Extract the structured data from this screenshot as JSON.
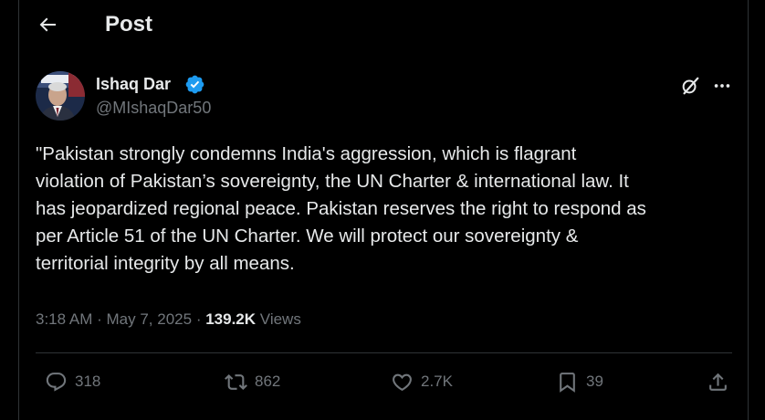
{
  "header": {
    "title": "Post"
  },
  "author": {
    "name": "Ishaq Dar",
    "handle": "@MIshaqDar50",
    "verified": true
  },
  "post": {
    "text": "\"Pakistan strongly condemns India's aggression, which is flagrant\nviolation of Pakistan’s sovereignty, the UN Charter & international law. It\nhas jeopardized regional peace. Pakistan reserves the right to respond as\nper Article 51 of the UN Charter. We will protect our sovereignty &\nterritorial integrity by all means.",
    "time": "3:18 AM",
    "date": "May 7, 2025",
    "separator": "·",
    "views_count": "139.2K",
    "views_label": "Views"
  },
  "actions": {
    "replies": "318",
    "reposts": "862",
    "likes": "2.7K",
    "bookmarks": "39"
  },
  "colors": {
    "background": "#000000",
    "text": "#e7e9ea",
    "muted": "#71767b",
    "verified": "#1d9bf0",
    "divider": "#2f3336"
  }
}
